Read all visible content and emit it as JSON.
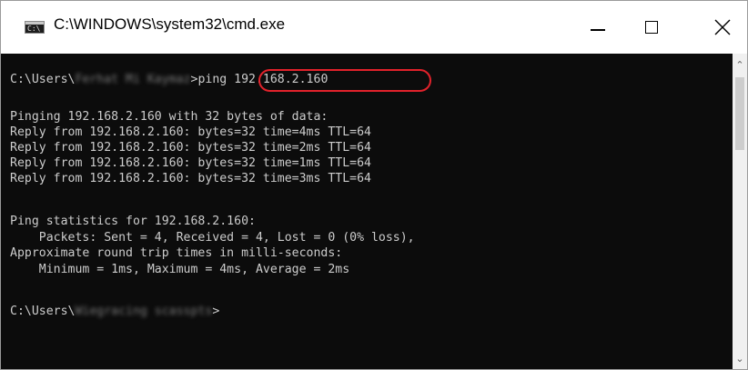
{
  "window": {
    "title": "C:\\WINDOWS\\system32\\cmd.exe",
    "icon": "cmd-app-icon",
    "controls": {
      "minimize": "minimize-icon",
      "maximize": "maximize-icon",
      "close": "close-icon"
    }
  },
  "console": {
    "prompt1_prefix": "C:\\Users\\",
    "prompt1_user": "Ferhat Mi Kaymaz",
    "prompt1_command": "ping 192.168.2.160",
    "lines": [
      "Pinging 192.168.2.160 with 32 bytes of data:",
      "Reply from 192.168.2.160: bytes=32 time=4ms TTL=64",
      "Reply from 192.168.2.160: bytes=32 time=2ms TTL=64",
      "Reply from 192.168.2.160: bytes=32 time=1ms TTL=64",
      "Reply from 192.168.2.160: bytes=32 time=3ms TTL=64",
      "Ping statistics for 192.168.2.160:",
      "    Packets: Sent = 4, Received = 4, Lost = 0 (0% loss),",
      "Approximate round trip times in milli-seconds:",
      "    Minimum = 1ms, Maximum = 4ms, Average = 2ms"
    ],
    "prompt2_prefix": "C:\\Users\\",
    "prompt2_user": "Wiegracing scasspts",
    "prompt2_suffix": ">"
  },
  "colors": {
    "console_bg": "#0c0c0c",
    "console_text": "#cccccc",
    "highlight": "#e2222b"
  }
}
